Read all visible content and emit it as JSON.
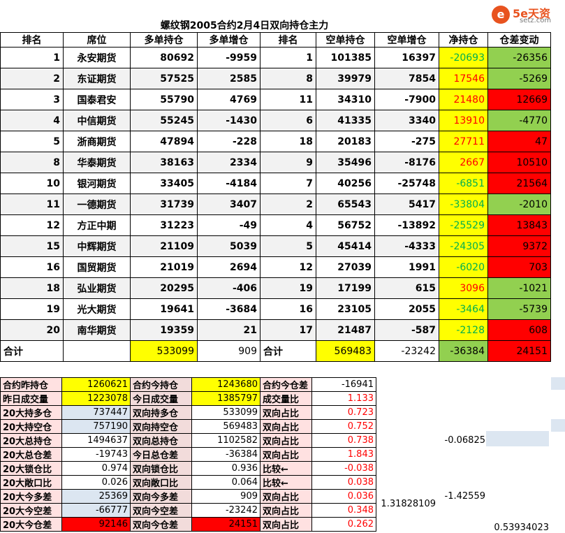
{
  "title": "螺纹钢2005合约2月4日双向持仓主力",
  "logo": {
    "mark": "e",
    "brand": "5e天资",
    "site": "setz.com"
  },
  "headers": [
    "排名",
    "席位",
    "多单持仓",
    "多单增仓",
    "排名",
    "空单持仓",
    "空单增仓",
    "净持仓",
    "仓差变动"
  ],
  "rows": [
    {
      "rank": "1",
      "seat": "永安期货",
      "long": "80692",
      "long_chg": "-9959",
      "rank2": "1",
      "short": "101385",
      "short_chg": "16397",
      "net": "-20693",
      "diff": "-26356",
      "net_color": "green",
      "diff_color": "green"
    },
    {
      "rank": "2",
      "seat": "东证期货",
      "long": "57525",
      "long_chg": "2585",
      "rank2": "8",
      "short": "39979",
      "short_chg": "7854",
      "net": "17546",
      "diff": "-5269",
      "net_color": "red",
      "diff_color": "green"
    },
    {
      "rank": "3",
      "seat": "国泰君安",
      "long": "55790",
      "long_chg": "4769",
      "rank2": "11",
      "short": "34310",
      "short_chg": "-7900",
      "net": "21480",
      "diff": "12669",
      "net_color": "red",
      "diff_color": "red"
    },
    {
      "rank": "4",
      "seat": "中信期货",
      "long": "55245",
      "long_chg": "-1430",
      "rank2": "6",
      "short": "41335",
      "short_chg": "3340",
      "net": "13910",
      "diff": "-4770",
      "net_color": "red",
      "diff_color": "green"
    },
    {
      "rank": "5",
      "seat": "浙商期货",
      "long": "47894",
      "long_chg": "-228",
      "rank2": "18",
      "short": "20183",
      "short_chg": "-275",
      "net": "27711",
      "diff": "47",
      "net_color": "red",
      "diff_color": "red"
    },
    {
      "rank": "8",
      "seat": "华泰期货",
      "long": "38163",
      "long_chg": "2334",
      "rank2": "9",
      "short": "35496",
      "short_chg": "-8176",
      "net": "2667",
      "diff": "10510",
      "net_color": "red",
      "diff_color": "red"
    },
    {
      "rank": "10",
      "seat": "银河期货",
      "long": "33405",
      "long_chg": "-4184",
      "rank2": "7",
      "short": "40256",
      "short_chg": "-25748",
      "net": "-6851",
      "diff": "21564",
      "net_color": "green",
      "diff_color": "red"
    },
    {
      "rank": "11",
      "seat": "一德期货",
      "long": "31739",
      "long_chg": "3407",
      "rank2": "2",
      "short": "65543",
      "short_chg": "5417",
      "net": "-33804",
      "diff": "-2010",
      "net_color": "green",
      "diff_color": "green"
    },
    {
      "rank": "12",
      "seat": "方正中期",
      "long": "31223",
      "long_chg": "-49",
      "rank2": "4",
      "short": "56752",
      "short_chg": "-13892",
      "net": "-25529",
      "diff": "13843",
      "net_color": "green",
      "diff_color": "red"
    },
    {
      "rank": "15",
      "seat": "中辉期货",
      "long": "21109",
      "long_chg": "5039",
      "rank2": "5",
      "short": "45414",
      "short_chg": "-4333",
      "net": "-24305",
      "diff": "9372",
      "net_color": "green",
      "diff_color": "red"
    },
    {
      "rank": "16",
      "seat": "国贸期货",
      "long": "21019",
      "long_chg": "2694",
      "rank2": "12",
      "short": "27039",
      "short_chg": "1991",
      "net": "-6020",
      "diff": "703",
      "net_color": "green",
      "diff_color": "red"
    },
    {
      "rank": "18",
      "seat": "弘业期货",
      "long": "20295",
      "long_chg": "-406",
      "rank2": "19",
      "short": "17199",
      "short_chg": "615",
      "net": "3096",
      "diff": "-1021",
      "net_color": "red",
      "diff_color": "green"
    },
    {
      "rank": "19",
      "seat": "光大期货",
      "long": "19641",
      "long_chg": "-3684",
      "rank2": "16",
      "short": "23105",
      "short_chg": "2055",
      "net": "-3464",
      "diff": "-5739",
      "net_color": "green",
      "diff_color": "green"
    },
    {
      "rank": "20",
      "seat": "南华期货",
      "long": "19359",
      "long_chg": "21",
      "rank2": "17",
      "short": "21487",
      "short_chg": "-587",
      "net": "-2128",
      "diff": "608",
      "net_color": "green",
      "diff_color": "red"
    }
  ],
  "total": {
    "label": "合计",
    "long": "533099",
    "long_chg": "909",
    "label2": "合计",
    "short": "569483",
    "short_chg": "-23242",
    "net": "-36384",
    "diff": "24151"
  },
  "stats": [
    {
      "l1": "合约昨持仓",
      "v1": "1260621",
      "l2": "合约今持仓",
      "v2": "1243680",
      "l3": "合约今仓差",
      "v3": "-16941",
      "extra": ""
    },
    {
      "l1": "昨日成交量",
      "v1": "1223078",
      "l2": "今日成交量",
      "v2": "1385797",
      "l3": "成交量比",
      "v3": "1.133",
      "extra": ""
    },
    {
      "l1": "20大持多仓",
      "v1": "737447",
      "l2": "双向持多仓",
      "v2": "533099",
      "l3": "双向占比",
      "v3": "0.723",
      "extra": ""
    },
    {
      "l1": "20大持空仓",
      "v1": "757190",
      "l2": "双向持空仓",
      "v2": "569483",
      "l3": "双向占比",
      "v3": "0.752",
      "extra": ""
    },
    {
      "l1": "20大总持仓",
      "v1": "1494637",
      "l2": "双向总持仓",
      "v2": "1102582",
      "l3": "双向占比",
      "v3": "0.738",
      "extra": "-0.06825"
    },
    {
      "l1": "20大总仓差",
      "v1": "-19743",
      "l2": "今日总仓差",
      "v2": "-36384",
      "l3": "双向占比",
      "v3": "1.843",
      "extra": ""
    },
    {
      "l1": "20大锁仓比",
      "v1": "0.974",
      "l2": "双向锁仓比",
      "v2": "0.936",
      "l3": "比较←",
      "v3": "-0.038",
      "extra": ""
    },
    {
      "l1": "20大敞口比",
      "v1": "0.026",
      "l2": "双向敞口比",
      "v2": "0.064",
      "l3": "比较←",
      "v3": "0.038",
      "extra": ""
    },
    {
      "l1": "20大今多差",
      "v1": "25369",
      "l2": "双向今多差",
      "v2": "909",
      "l3": "双向占比",
      "v3": "0.036",
      "extra": "-1.42559"
    },
    {
      "l1": "20大今空差",
      "v1": "-66777",
      "l2": "双向今空差",
      "v2": "-23242",
      "l3": "双向占比",
      "v3": "0.348",
      "extra": ""
    },
    {
      "l1": "20大今仓差",
      "v1": "92146",
      "l2": "双向今仓差",
      "v2": "24151",
      "l3": "双向占比",
      "v3": "0.262",
      "extra": ""
    }
  ],
  "extra_value_1": "1.31828109",
  "extra_value_2": "0.53934023"
}
